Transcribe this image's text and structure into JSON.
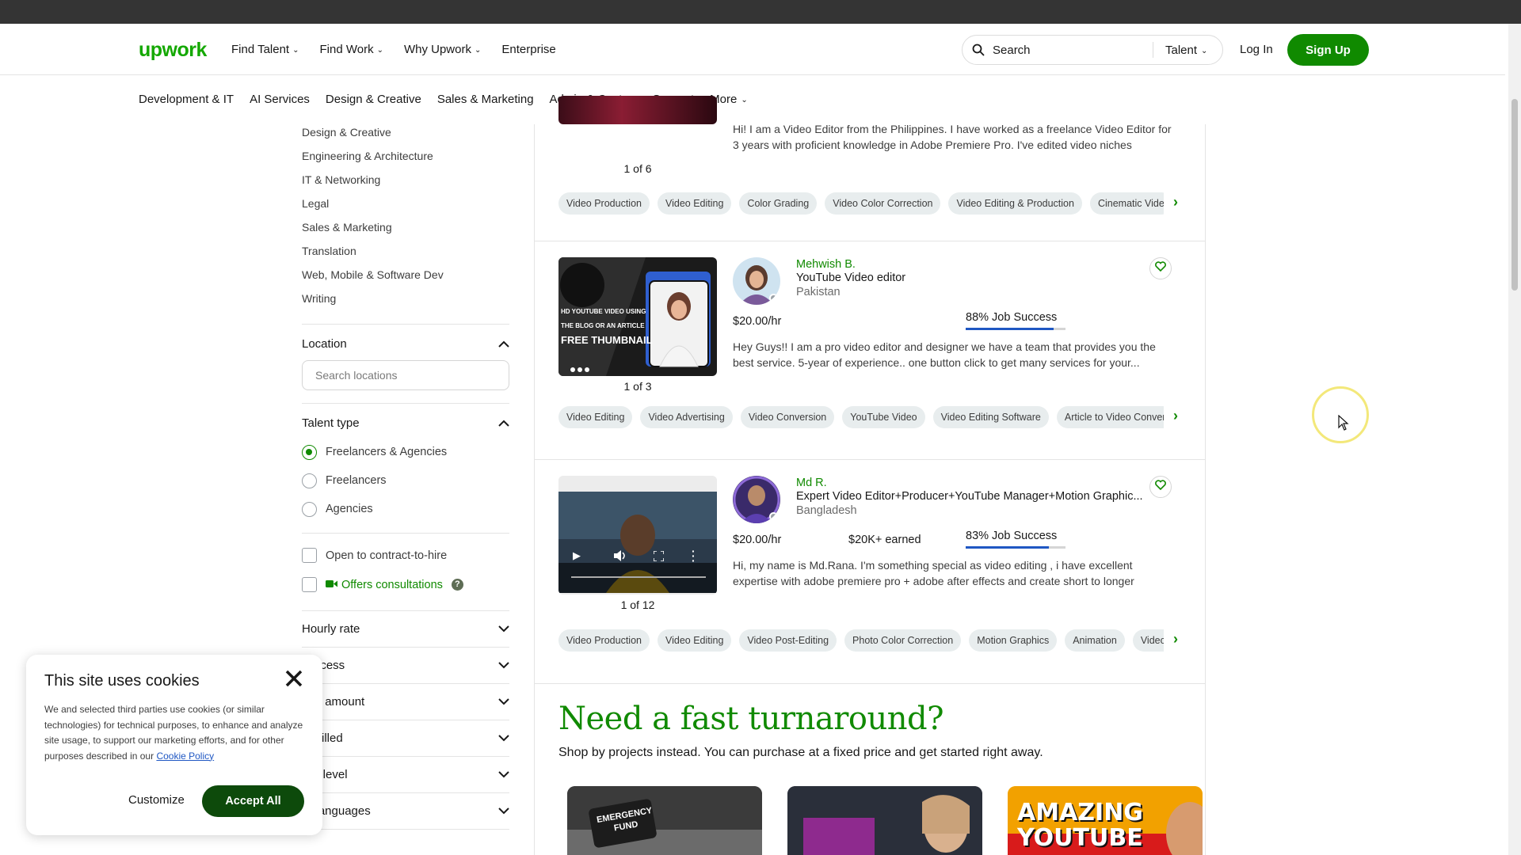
{
  "header": {
    "logo": "upwork",
    "nav": [
      "Find Talent",
      "Find Work",
      "Why Upwork",
      "Enterprise"
    ],
    "search_placeholder": "Search",
    "search_type": "Talent",
    "login": "Log In",
    "signup": "Sign Up"
  },
  "categories": [
    "Development & IT",
    "AI Services",
    "Design & Creative",
    "Sales & Marketing",
    "Admin & Customer Support",
    "More"
  ],
  "sidebar": {
    "category_list": [
      "Design & Creative",
      "Engineering & Architecture",
      "IT & Networking",
      "Legal",
      "Sales & Marketing",
      "Translation",
      "Web, Mobile & Software Dev",
      "Writing"
    ],
    "location_label": "Location",
    "location_placeholder": "Search locations",
    "talent_type_label": "Talent type",
    "talent_types": [
      "Freelancers & Agencies",
      "Freelancers",
      "Agencies"
    ],
    "selected_talent_type": "Freelancers & Agencies",
    "contract_to_hire": "Open to contract-to-hire",
    "offers_consultations": "Offers consultations",
    "accordions": [
      "Hourly rate",
      "success",
      "ned amount",
      "rs billed",
      "lish level",
      "er languages"
    ]
  },
  "freelancers": [
    {
      "desc": "Hi! I am a Video Editor from the Philippines. I have worked as a freelance Video Editor for 3 years with proficient knowledge in Adobe Premiere Pro. I've edited video niches",
      "counter": "1 of 6",
      "tags": [
        "Video Production",
        "Video Editing",
        "Color Grading",
        "Video Color Correction",
        "Video Editing & Production",
        "Cinematic Vide"
      ]
    },
    {
      "name": "Mehwish B.",
      "title": "YouTube Video editor",
      "country": "Pakistan",
      "rate": "$20.00/hr",
      "earned": "",
      "job_success": "88% Job Success",
      "job_success_pct": 88,
      "desc": "Hey Guys!! I am a pro video editor and designer we have a team that provides you the best service. 5-year of experience.. one button click to get many services for your...",
      "counter": "1 of 3",
      "thumb_text": [
        "HD YOUTUBE VIDEO USING",
        "THE BLOG OR AN ARTICLE",
        "FREE THUMBNAIL"
      ],
      "tags": [
        "Video Editing",
        "Video Advertising",
        "Video Conversion",
        "YouTube Video",
        "Video Editing Software",
        "Article to Video Conver"
      ]
    },
    {
      "name": "Md R.",
      "title": "Expert Video Editor+Producer+YouTube Manager+Motion Graphic...",
      "country": "Bangladesh",
      "rate": "$20.00/hr",
      "earned": "$20K+ earned",
      "job_success": "83% Job Success",
      "job_success_pct": 83,
      "desc": "Hi, my name is Md.Rana. I'm something special as video editing , i have excellent expertise with adobe premiere pro + adobe after effects and create short to longer",
      "counter": "1 of 12",
      "tags": [
        "Video Production",
        "Video Editing",
        "Video Post-Editing",
        "Photo Color Correction",
        "Motion Graphics",
        "Animation",
        "Video I"
      ]
    }
  ],
  "promo": {
    "title": "Need a fast turnaround?",
    "subtitle": "Shop by projects instead. You can purchase at a fixed price and get started right away.",
    "project_texts": [
      "EMERGENCY FUND",
      "AMAZING YOUTUBE"
    ]
  },
  "cookie": {
    "title": "This site uses cookies",
    "body": "We and selected third parties use cookies (or similar technologies) for technical purposes, to enhance and analyze site usage, to support our marketing efforts, and for other purposes described in our",
    "link": "Cookie Policy",
    "customize": "Customize",
    "accept": "Accept All"
  },
  "colors": {
    "brand_green": "#14a800",
    "button_green": "#108a00",
    "accept_dark": "#0d4a0b",
    "jss_blue": "#1f57c3"
  }
}
